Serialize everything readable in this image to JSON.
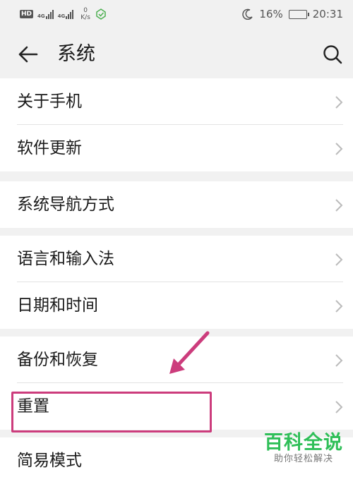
{
  "status_bar": {
    "hd": "HD",
    "net1": "4G",
    "net2": "4G",
    "speed_value": "0",
    "speed_unit": "K/s",
    "battery": "16%",
    "time": "20:31"
  },
  "header": {
    "title": "系统"
  },
  "groups": [
    {
      "items": [
        {
          "label": "关于手机"
        },
        {
          "label": "软件更新"
        }
      ]
    },
    {
      "items": [
        {
          "label": "系统导航方式"
        }
      ]
    },
    {
      "items": [
        {
          "label": "语言和输入法"
        },
        {
          "label": "日期和时间"
        }
      ]
    },
    {
      "items": [
        {
          "label": "备份和恢复"
        },
        {
          "label": "重置"
        }
      ]
    },
    {
      "items": [
        {
          "label": "简易模式"
        }
      ]
    }
  ],
  "annotation": {
    "color": "#cc3c7c",
    "highlighted_item": "重置"
  },
  "watermark": {
    "main": "百科全说",
    "sub": "助你轻松解决",
    "color": "#2fbf58"
  }
}
